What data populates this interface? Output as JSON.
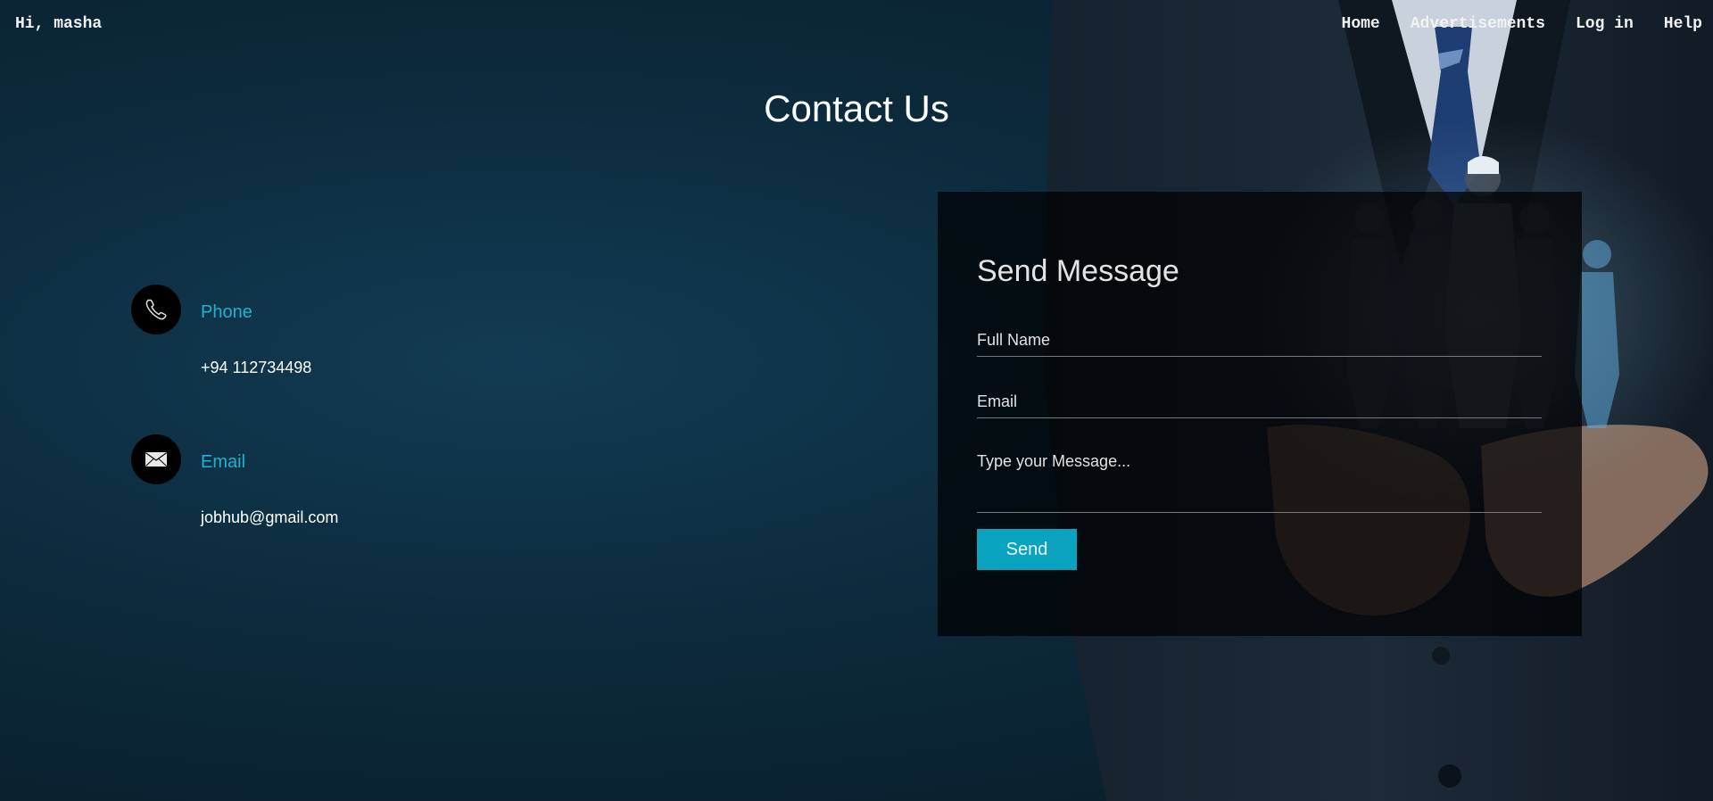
{
  "header": {
    "greeting": "Hi, masha",
    "nav": [
      "Home",
      "Advertisements",
      "Log in",
      "Help"
    ]
  },
  "page_title": "Contact Us",
  "contact": {
    "phone": {
      "icon": "phone-icon",
      "heading": "Phone",
      "value": "+94 112734498"
    },
    "email": {
      "icon": "envelope-icon",
      "heading": "Email",
      "value": "jobhub@gmail.com"
    }
  },
  "form": {
    "title": "Send Message",
    "full_name_placeholder": "Full Name",
    "email_placeholder": "Email",
    "message_placeholder": "Type your Message...",
    "send_label": "Send"
  },
  "colors": {
    "accent": "#1fb3d1",
    "button": "#0aa3bf",
    "background": "#0c2a3c"
  }
}
